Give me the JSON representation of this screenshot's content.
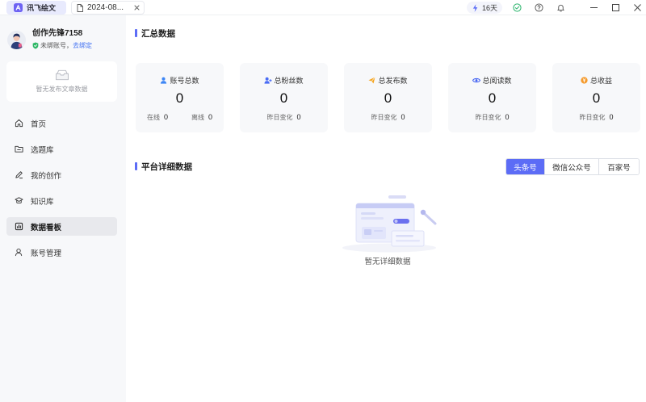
{
  "colors": {
    "accent": "#5c6cf6",
    "link": "#3f6ff2",
    "sidebar_bg": "#f7f8fa",
    "card_bg": "#f7f8fa",
    "active_nav_bg": "#e8e9ed",
    "online_green": "#2fb867"
  },
  "titlebar": {
    "app_tab": {
      "label": "讯飞绘文",
      "icon": "app-logo-icon"
    },
    "doc_tab": {
      "label": "2024-08...",
      "icon": "document-icon",
      "close_icon": "tab-close-icon"
    },
    "membership": {
      "label": "16天",
      "icon": "lightning-icon"
    },
    "icons": [
      "check-circle-icon",
      "help-circle-icon",
      "bell-icon",
      "minimize-icon",
      "maximize-icon",
      "close-icon"
    ]
  },
  "sidebar": {
    "user": {
      "name": "创作先锋7158",
      "status_icon": "shield-check-icon",
      "status_text": "未绑账号，",
      "bind_link": "去绑定"
    },
    "article_card": {
      "icon": "empty-inbox-icon",
      "empty_text": "暂无发布文章数据"
    },
    "nav": [
      {
        "label": "首页",
        "icon": "home-icon",
        "active": false
      },
      {
        "label": "选题库",
        "icon": "folder-icon",
        "active": false
      },
      {
        "label": "我的创作",
        "icon": "pen-icon",
        "active": false
      },
      {
        "label": "知识库",
        "icon": "graduation-cap-icon",
        "active": false
      },
      {
        "label": "数据看板",
        "icon": "chart-icon",
        "active": true
      },
      {
        "label": "账号管理",
        "icon": "user-icon",
        "active": false
      }
    ]
  },
  "summary": {
    "title": "汇总数据",
    "cards": [
      {
        "label": "账号总数",
        "icon": "user-filled-icon",
        "value": "0",
        "stats": [
          {
            "label": "在线",
            "value": "0"
          },
          {
            "label": "离线",
            "value": "0"
          }
        ]
      },
      {
        "label": "总粉丝数",
        "icon": "user-plus-icon",
        "value": "0",
        "stats": [
          {
            "label": "昨日变化",
            "value": "0"
          }
        ]
      },
      {
        "label": "总发布数",
        "icon": "send-icon",
        "value": "0",
        "stats": [
          {
            "label": "昨日变化",
            "value": "0"
          }
        ]
      },
      {
        "label": "总阅读数",
        "icon": "eye-icon",
        "value": "0",
        "stats": [
          {
            "label": "昨日变化",
            "value": "0"
          }
        ]
      },
      {
        "label": "总收益",
        "icon": "coin-icon",
        "value": "0",
        "stats": [
          {
            "label": "昨日变化",
            "value": "0"
          }
        ]
      }
    ]
  },
  "platform": {
    "title": "平台详细数据",
    "tabs": [
      {
        "label": "头条号",
        "active": true
      },
      {
        "label": "微信公众号",
        "active": false
      },
      {
        "label": "百家号",
        "active": false
      }
    ],
    "empty_text": "暂无详细数据"
  }
}
